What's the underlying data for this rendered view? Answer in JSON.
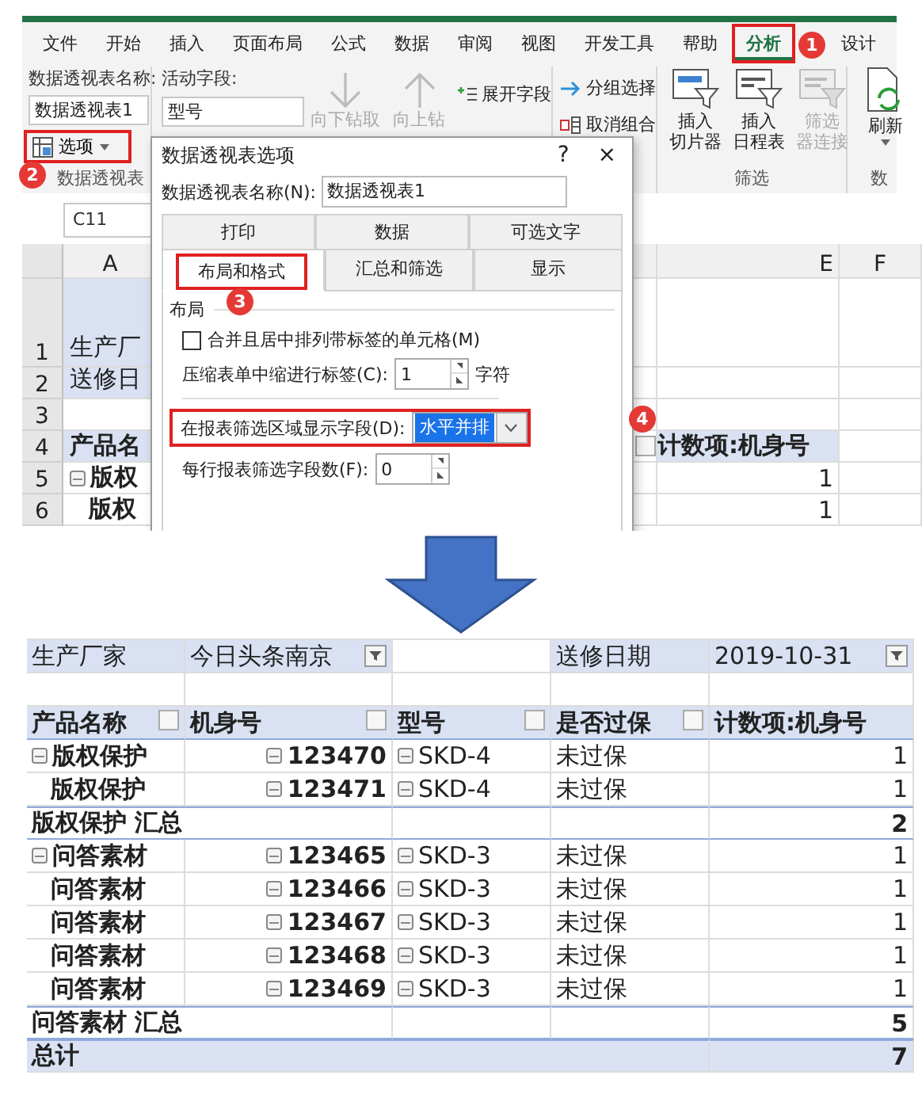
{
  "ribbon": {
    "tabs": [
      {
        "label": "文件",
        "selected": false,
        "highlighted": false
      },
      {
        "label": "开始",
        "selected": false,
        "highlighted": false
      },
      {
        "label": "插入",
        "selected": false,
        "highlighted": false
      },
      {
        "label": "页面布局",
        "selected": false,
        "highlighted": false
      },
      {
        "label": "公式",
        "selected": false,
        "highlighted": false
      },
      {
        "label": "数据",
        "selected": false,
        "highlighted": false
      },
      {
        "label": "审阅",
        "selected": false,
        "highlighted": false
      },
      {
        "label": "视图",
        "selected": false,
        "highlighted": false
      },
      {
        "label": "开发工具",
        "selected": false,
        "highlighted": false
      },
      {
        "label": "帮助",
        "selected": false,
        "highlighted": false
      },
      {
        "label": "分析",
        "selected": true,
        "highlighted": true,
        "callout": "1"
      },
      {
        "label": "设计",
        "selected": false,
        "highlighted": false
      }
    ],
    "pivot_group": {
      "name_label": "数据透视表名称:",
      "name_value": "数据透视表1",
      "options": {
        "label": "选项",
        "highlighted": true,
        "callout": "2"
      },
      "group_label": "数据透视表"
    },
    "active_field_group": {
      "label": "活动字段:",
      "value": "型号",
      "buttons": [
        {
          "label": "向下钻取",
          "kind": "down",
          "disabled": true
        },
        {
          "label": "向上钻",
          "kind": "up",
          "disabled": true
        }
      ],
      "field_actions": [
        {
          "label": "展开字段",
          "kind": "expand"
        }
      ]
    },
    "group_group": {
      "actions": [
        {
          "label": "分组选择",
          "kind": "group"
        },
        {
          "label": "取消组合",
          "kind": "ungroup"
        }
      ]
    },
    "filter_group": {
      "buttons": [
        {
          "lines": [
            "插入",
            "切片器"
          ],
          "kind": "slicer",
          "disabled": false
        },
        {
          "lines": [
            "插入",
            "日程表"
          ],
          "kind": "timeline",
          "disabled": false
        },
        {
          "lines": [
            "筛选",
            "器连接"
          ],
          "kind": "connections",
          "disabled": true
        }
      ],
      "group_label": "筛选"
    },
    "data_group": {
      "refresh": "刷新",
      "group_label": "数"
    }
  },
  "sheet": {
    "name_box": "C11",
    "columns": [
      "A",
      "E",
      "F"
    ],
    "rows": [
      {
        "number": "1",
        "kind": "filter",
        "cell_a": "生产厂"
      },
      {
        "number": "2",
        "kind": "filter",
        "cell_a": "送修日"
      },
      {
        "number": "3",
        "kind": "blank"
      },
      {
        "number": "4",
        "kind": "header",
        "cell_a": "产品名",
        "cell_e": "计数项:机身号"
      },
      {
        "number": "5",
        "kind": "item",
        "cell_a": "版权",
        "cell_e": "1",
        "group_start": true
      },
      {
        "number": "6",
        "kind": "item",
        "cell_a": "版权",
        "cell_e": "1",
        "group_start": false
      }
    ]
  },
  "dialog": {
    "title": "数据透视表选项",
    "help": "?",
    "close": "×",
    "name_label": "数据透视表名称(N):",
    "name_value": "数据透视表1",
    "tab_rows": [
      [
        {
          "label": "打印",
          "selected": false
        },
        {
          "label": "数据",
          "selected": false
        },
        {
          "label": "可选文字",
          "selected": false
        }
      ],
      [
        {
          "label": "布局和格式",
          "selected": true,
          "highlighted": true,
          "callout": "3"
        },
        {
          "label": "汇总和筛选",
          "selected": false,
          "highlighted": false
        },
        {
          "label": "显示",
          "selected": false,
          "highlighted": false
        }
      ]
    ],
    "section": "布局",
    "merge_checkbox": {
      "label": "合并且居中排列带标签的单元格(M)",
      "checked": false
    },
    "indent": {
      "label": "压缩表单中缩进行标签(C):",
      "value": "1",
      "unit": "字符"
    },
    "filter_display": {
      "label": "在报表筛选区域显示字段(D):",
      "value": "水平并排",
      "highlighted": true,
      "callout": "4"
    },
    "fields_per_row": {
      "label": "每行报表筛选字段数(F):",
      "value": "0"
    }
  },
  "pivot": {
    "filters": [
      {
        "label": "生产厂家",
        "value": "今日头条南京"
      },
      {
        "label": "送修日期",
        "value": "2019-10-31"
      }
    ],
    "columns": [
      "产品名称",
      "机身号",
      "型号",
      "是否过保",
      "计数项:机身号"
    ],
    "rows": [
      {
        "kind": "item",
        "group_start": true,
        "product": "版权保护",
        "serial": "123470",
        "model": "SKD-4",
        "warranty": "未过保",
        "count": "1"
      },
      {
        "kind": "item",
        "group_start": false,
        "product": "版权保护",
        "serial": "123471",
        "model": "SKD-4",
        "warranty": "未过保",
        "count": "1"
      },
      {
        "kind": "subtotal",
        "label": "版权保护 汇总",
        "count": "2"
      },
      {
        "kind": "item",
        "group_start": true,
        "product": "问答素材",
        "serial": "123465",
        "model": "SKD-3",
        "warranty": "未过保",
        "count": "1"
      },
      {
        "kind": "item",
        "group_start": false,
        "product": "问答素材",
        "serial": "123466",
        "model": "SKD-3",
        "warranty": "未过保",
        "count": "1"
      },
      {
        "kind": "item",
        "group_start": false,
        "product": "问答素材",
        "serial": "123467",
        "model": "SKD-3",
        "warranty": "未过保",
        "count": "1"
      },
      {
        "kind": "item",
        "group_start": false,
        "product": "问答素材",
        "serial": "123468",
        "model": "SKD-3",
        "warranty": "未过保",
        "count": "1"
      },
      {
        "kind": "item",
        "group_start": false,
        "product": "问答素材",
        "serial": "123469",
        "model": "SKD-3",
        "warranty": "未过保",
        "count": "1"
      },
      {
        "kind": "subtotal",
        "label": "问答素材 汇总",
        "count": "5"
      },
      {
        "kind": "total",
        "label": "总计",
        "count": "7"
      }
    ]
  }
}
